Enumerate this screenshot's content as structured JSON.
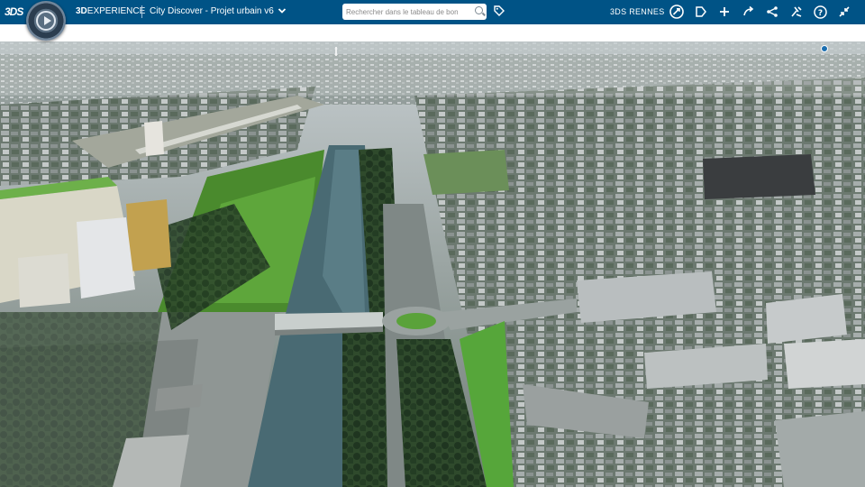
{
  "header": {
    "logo_text": "3DS",
    "brand_bold": "3D",
    "brand_rest": "EXPERIENCE",
    "app_title": "City Discover - Projet urbain v6",
    "title_chevron": "chevron-down-icon",
    "search_placeholder": "Rechercher dans le tableau de bon",
    "tenant": "3DS RENNES",
    "icons": [
      "user-avatar-icon",
      "tag-icon",
      "add-icon",
      "share-icon",
      "network-icon",
      "tools-icon",
      "help-icon",
      "collapse-icon"
    ]
  },
  "scene": {
    "description_id": "3d-city-view",
    "colors": {
      "river": "#4f6f78",
      "grass": "#4f9a32",
      "road": "#8e9696",
      "roof": "#c9cfd0"
    }
  }
}
